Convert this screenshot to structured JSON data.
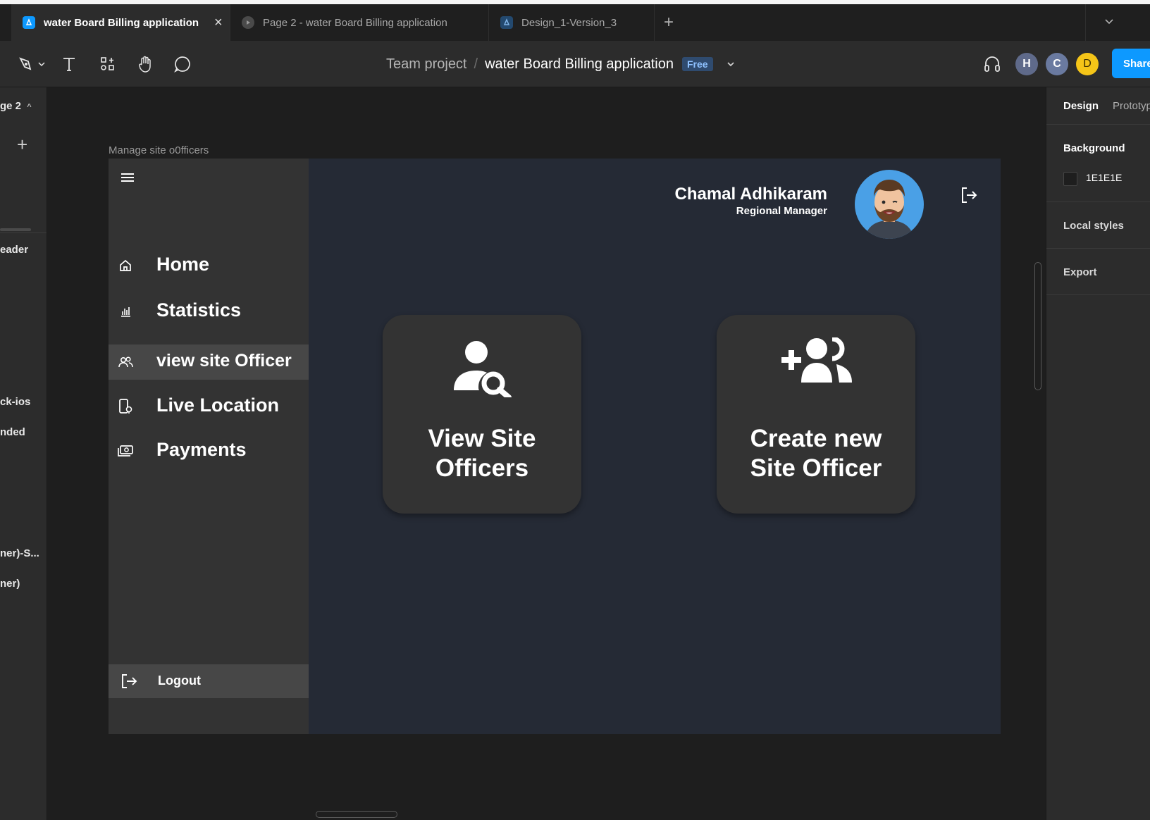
{
  "tabs": [
    {
      "label": "water Board Billing application",
      "active": true,
      "icon": "figma-file-icon"
    },
    {
      "label": "Page 2 - water Board Billing application",
      "active": false,
      "icon": "play-icon"
    },
    {
      "label": "Design_1-Version_3",
      "active": false,
      "icon": "figma-file-icon"
    }
  ],
  "toolbar": {
    "breadcrumb_team": "Team project",
    "breadcrumb_sep": "/",
    "project_name": "water Board Billing application",
    "plan_badge": "Free",
    "collaborators": [
      {
        "initial": "H",
        "color": "#5f6a8a"
      },
      {
        "initial": "C",
        "color": "#6a7aa0"
      },
      {
        "initial": "D",
        "color": "#f5c518"
      }
    ],
    "share_label": "Share"
  },
  "left_panel": {
    "page_label": "ge 2",
    "layers": [
      "eader",
      "ck-ios",
      "nded",
      "ner)-S...",
      "ner)"
    ]
  },
  "right_panel": {
    "tab_design": "Design",
    "tab_prototype": "Prototyp",
    "background_label": "Background",
    "background_value": "1E1E1E",
    "local_styles": "Local styles",
    "export": "Export"
  },
  "canvas": {
    "frame_label": "Manage site o0fficers"
  },
  "app": {
    "nav": [
      {
        "label": "Home",
        "icon": "home-icon",
        "selected": false
      },
      {
        "label": "Statistics",
        "icon": "bar-chart-icon",
        "selected": false
      },
      {
        "label": "view site Officer",
        "icon": "users-icon",
        "selected": true
      },
      {
        "label": "Live Location",
        "icon": "location-phone-icon",
        "selected": false
      },
      {
        "label": "Payments",
        "icon": "payments-icon",
        "selected": false
      }
    ],
    "logout_label": "Logout",
    "user_name": "Chamal Adhikaram",
    "user_role": "Regional Manager",
    "cards": [
      {
        "title_line1": "View Site",
        "title_line2": "Officers",
        "icon": "user-search-icon"
      },
      {
        "title_line1": "Create new",
        "title_line2": "Site Officer",
        "icon": "add-users-icon"
      }
    ]
  },
  "colors": {
    "canvas_bg": "#1e1e1e",
    "frame_bg": "#252a35",
    "sidebar_bg": "#333333",
    "selected_bg": "#474747",
    "accent": "#0d99ff"
  }
}
